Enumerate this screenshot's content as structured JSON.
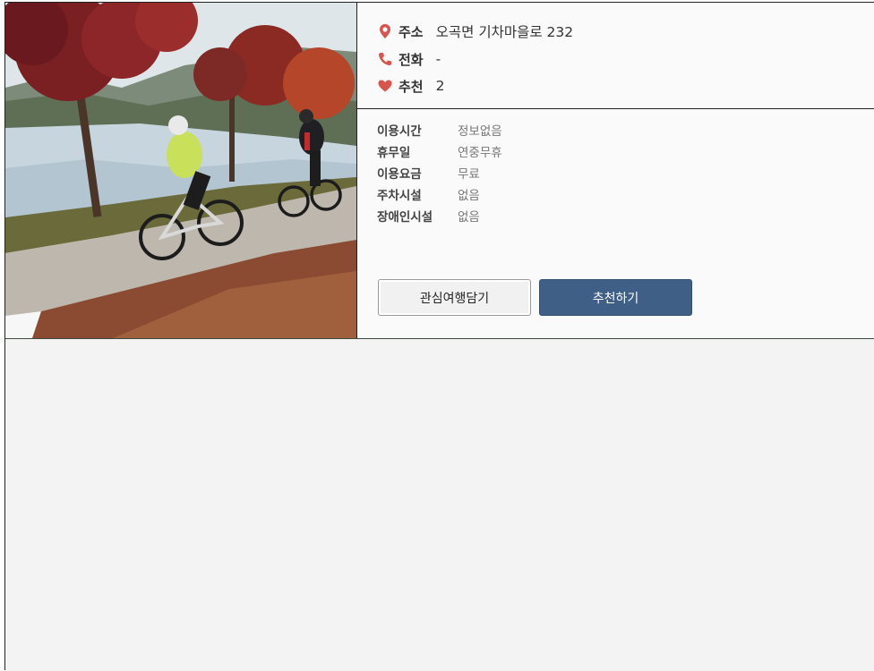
{
  "info": {
    "address": {
      "label": "주소",
      "value": "오곡면 기차마을로 232",
      "icon": "map-pin-icon",
      "icon_color": "#d9534f"
    },
    "phone": {
      "label": "전화",
      "value": "-",
      "icon": "phone-icon",
      "icon_color": "#d9534f"
    },
    "recommend": {
      "label": "추천",
      "value": "2",
      "icon": "heart-icon",
      "icon_color": "#d9534f"
    }
  },
  "details": [
    {
      "label": "이용시간",
      "value": "정보없음"
    },
    {
      "label": "휴무일",
      "value": "연중무휴"
    },
    {
      "label": "이용요금",
      "value": "무료"
    },
    {
      "label": "주차시설",
      "value": "없음"
    },
    {
      "label": "장애인시설",
      "value": "없음"
    }
  ],
  "buttons": {
    "interest": "관심여행담기",
    "recommend": "추천하기"
  },
  "colors": {
    "accent": "#3f5f87",
    "icon": "#d9534f"
  }
}
